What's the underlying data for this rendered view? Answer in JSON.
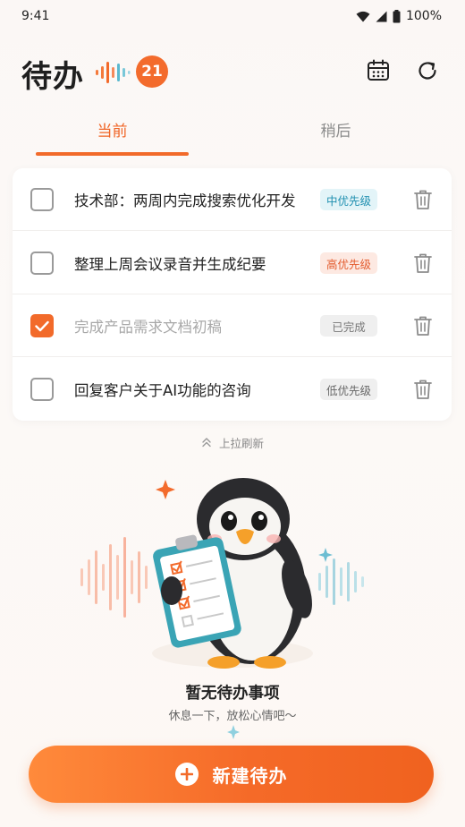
{
  "status_bar": {
    "time": "9:41",
    "battery": "100%"
  },
  "header": {
    "title": "待办",
    "count": "21"
  },
  "tabs": [
    {
      "label": "当前",
      "active": true
    },
    {
      "label": "稍后",
      "active": false
    }
  ],
  "tasks": [
    {
      "text": "技术部：两周内完成搜索优化开发",
      "badge": "中优先级",
      "badge_type": "mid",
      "checked": false
    },
    {
      "text": "整理上周会议录音并生成纪要",
      "badge": "高优先级",
      "badge_type": "high",
      "checked": false
    },
    {
      "text": "完成产品需求文档初稿",
      "badge": "已完成",
      "badge_type": "done",
      "checked": true
    },
    {
      "text": "回复客户关于AI功能的咨询",
      "badge": "低优先级",
      "badge_type": "low",
      "checked": false
    }
  ],
  "pull_hint": "上拉刷新",
  "empty_state": {
    "title": "暂无待办事项",
    "subtitle": "休息一下，放松心情吧～"
  },
  "new_button": {
    "label": "新建待办"
  },
  "colors": {
    "accent": "#f26a2a",
    "mid_badge": "#1f8fb0",
    "high_badge": "#e35a2c"
  },
  "icons": [
    "wifi-icon",
    "signal-icon",
    "battery-icon",
    "sound-wave-icon",
    "calendar-icon",
    "refresh-icon",
    "checkmark-icon",
    "trash-icon",
    "chevron-up-icon",
    "penguin-illustration",
    "plus-icon"
  ]
}
